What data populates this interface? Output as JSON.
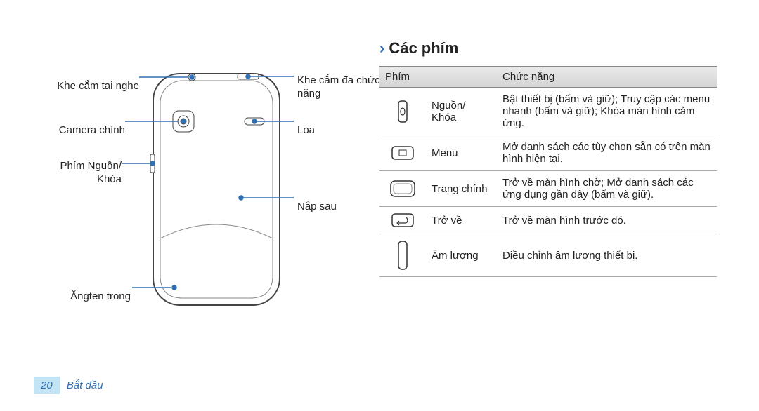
{
  "heading": "Các phím",
  "tableHeader": {
    "key": "Phím",
    "func": "Chức năng"
  },
  "rows": [
    {
      "name": "Nguồn/ Khóa",
      "func": "Bật thiết bị (bấm và giữ); Truy cập các menu nhanh (bấm và giữ); Khóa màn hình cảm ứng."
    },
    {
      "name": "Menu",
      "func": "Mở danh sách các tùy chọn sẵn có trên màn hình hiện tại."
    },
    {
      "name": "Trang chính",
      "func": "Trở về màn hình chờ; Mở danh sách các ứng dụng gần đây (bấm và giữ)."
    },
    {
      "name": "Trở về",
      "func": "Trở về màn hình trước đó."
    },
    {
      "name": "Âm lượng",
      "func": "Điều chỉnh âm lượng thiết bị."
    }
  ],
  "diagramLabels": {
    "headphone": "Khe cắm tai nghe",
    "camera": "Camera chính",
    "power": "Phím Nguồn/ Khóa",
    "antenna": "Ăngten trong",
    "multiSlot": "Khe cắm đa chức năng",
    "speaker": "Loa",
    "backCover": "Nắp sau"
  },
  "footer": {
    "page": "20",
    "section": "Bắt đầu"
  }
}
